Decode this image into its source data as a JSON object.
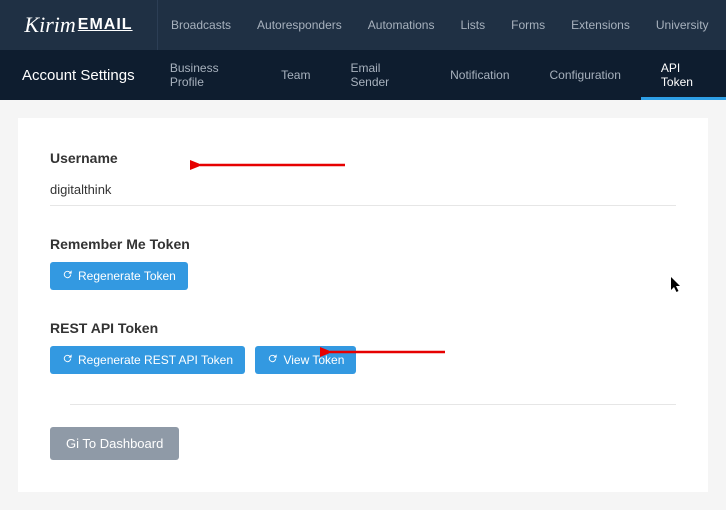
{
  "logo": {
    "part1": "Kirim",
    "part2": "EMAIL"
  },
  "topnav": [
    "Broadcasts",
    "Autoresponders",
    "Automations",
    "Lists",
    "Forms",
    "Extensions",
    "University"
  ],
  "subnav": {
    "title": "Account Settings",
    "tabs": [
      "Business Profile",
      "Team",
      "Email Sender",
      "Notification",
      "Configuration",
      "API Token"
    ]
  },
  "sections": {
    "username": {
      "label": "Username",
      "value": "digitalthink"
    },
    "remember": {
      "label": "Remember Me Token",
      "regenerate_label": "Regenerate Token"
    },
    "rest": {
      "label": "REST API Token",
      "regenerate_label": "Regenerate REST API Token",
      "view_label": "View Token"
    }
  },
  "dashboard_button": "Gi To Dashboard"
}
